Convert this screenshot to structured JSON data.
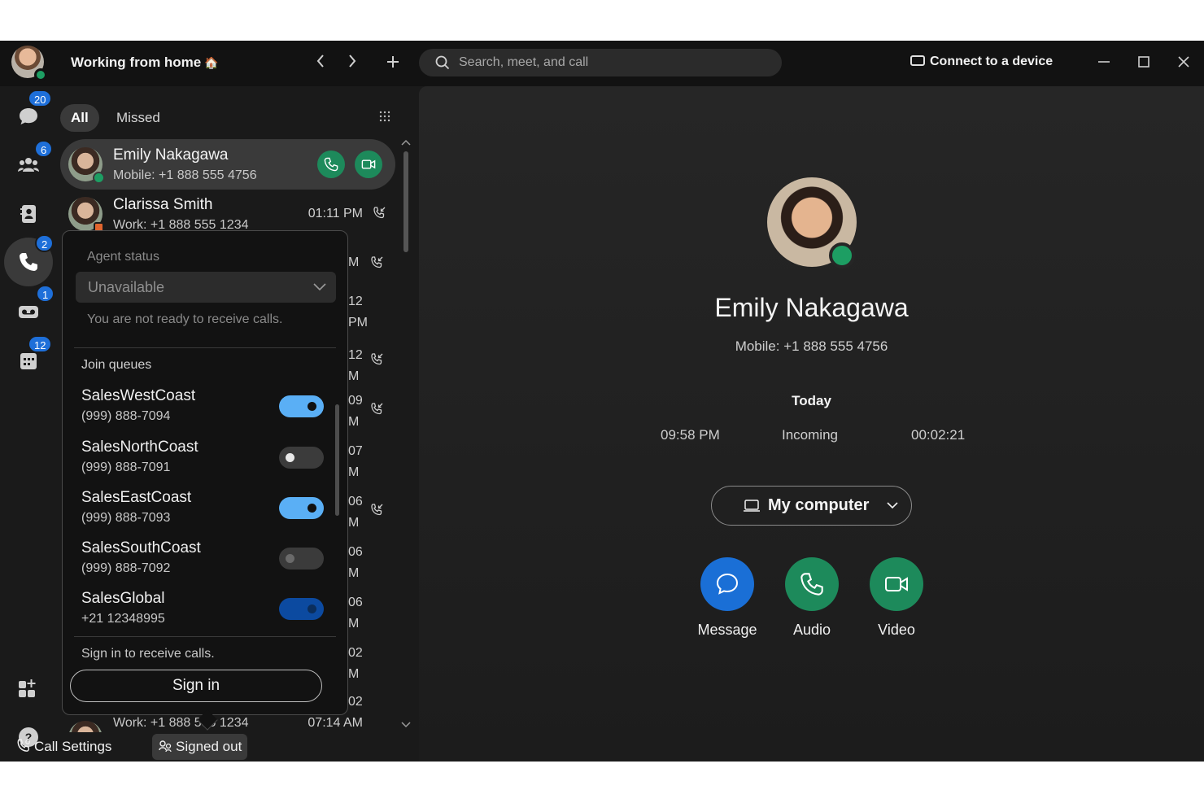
{
  "header": {
    "status_text": "Working from home",
    "status_emoji": "🏠",
    "search_placeholder": "Search, meet, and call",
    "connect_label": "Connect to a device"
  },
  "rail": {
    "messaging_badge": "20",
    "teams_badge": "6",
    "calling_badge": "2",
    "voicemail_badge": "1",
    "meetings_badge": "12"
  },
  "tabs": [
    {
      "label": "All",
      "active": true
    },
    {
      "label": "Missed",
      "active": false
    }
  ],
  "calls": [
    {
      "name": "Emily Nakagawa",
      "sub": "Mobile: +1 888 555 4756",
      "time": "",
      "selected": true
    },
    {
      "name": "Clarissa Smith",
      "sub": "Work: +1 888 555 1234",
      "time": "01:11 PM"
    }
  ],
  "partial_times": [
    {
      "line1": "M",
      "line2": ""
    },
    {
      "line1": "12",
      "line2": "PM"
    },
    {
      "line1": "12",
      "line2": "M"
    },
    {
      "line1": "09",
      "line2": "M"
    },
    {
      "line1": "07",
      "line2": "M"
    },
    {
      "line1": "06",
      "line2": "M"
    },
    {
      "line1": "06",
      "line2": "M"
    },
    {
      "line1": "06",
      "line2": "M"
    },
    {
      "line1": "02",
      "line2": "M"
    },
    {
      "line1": "02",
      "line2": ""
    }
  ],
  "last_row": {
    "sub": "Work: +1 888 555 1234",
    "time": "07:14 AM"
  },
  "popup": {
    "agent_status_label": "Agent status",
    "agent_status_value": "Unavailable",
    "agent_status_note": "You are not ready to receive calls.",
    "join_queues_label": "Join queues",
    "queues": [
      {
        "name": "SalesWestCoast",
        "number": "(999) 888-7094",
        "state": "on"
      },
      {
        "name": "SalesNorthCoast",
        "number": "(999) 888-7091",
        "state": "off"
      },
      {
        "name": "SalesEastCoast",
        "number": "(999) 888-7093",
        "state": "on"
      },
      {
        "name": "SalesSouthCoast",
        "number": "(999) 888-7092",
        "state": "dim"
      },
      {
        "name": "SalesGlobal",
        "number": "+21 12348995",
        "state": "onlock"
      }
    ],
    "sign_in_note": "Sign in to receive calls.",
    "sign_in_button": "Sign in"
  },
  "footer": {
    "call_settings": "Call Settings",
    "signed_out": "Signed out"
  },
  "detail": {
    "name": "Emily Nakagawa",
    "sub": "Mobile: +1 888 555 4756",
    "today_label": "Today",
    "log_time": "09:58 PM",
    "log_direction": "Incoming",
    "log_duration": "00:02:21",
    "device_label": "My computer",
    "actions": [
      {
        "label": "Message",
        "color": "#1a6fd6"
      },
      {
        "label": "Audio",
        "color": "#1d8a5b"
      },
      {
        "label": "Video",
        "color": "#1d8a5b"
      }
    ]
  },
  "colors": {
    "presence_green": "#1d9e63",
    "badge_blue": "#1e6fd9",
    "toggle_on": "#5aaff5"
  }
}
